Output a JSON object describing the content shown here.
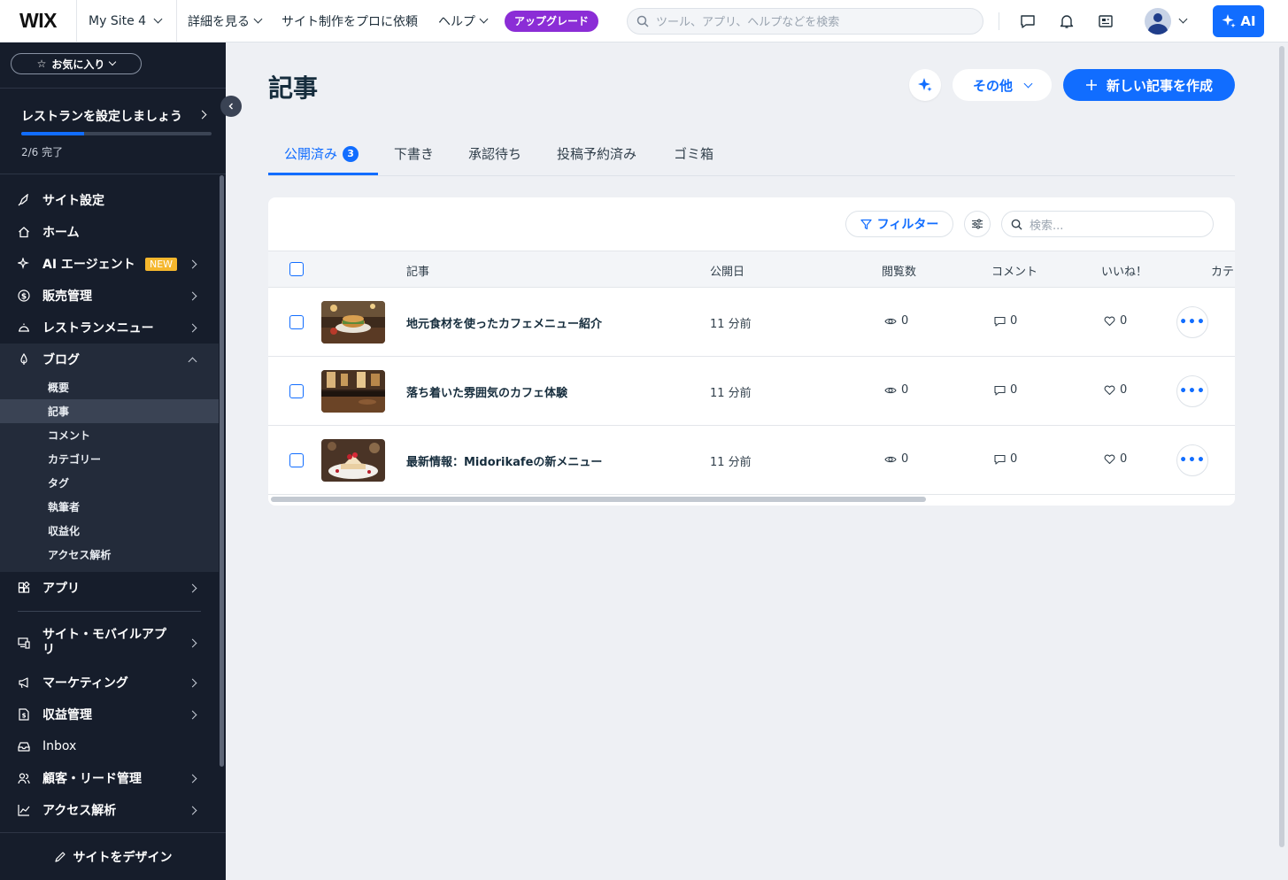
{
  "topbar": {
    "logo": "WIX",
    "site_name": "My Site 4",
    "nav": [
      "詳細を見る",
      "サイト制作をプロに依頼",
      "ヘルプ"
    ],
    "upgrade": "アップグレード",
    "search_placeholder": "ツール、アプリ、ヘルプなどを検索",
    "ai_label": "AI"
  },
  "sidebar": {
    "favorites": "お気に入り",
    "setup_title": "レストランを設定しましょう",
    "setup_progress": "2/6 完了",
    "setup_fraction": 0.33,
    "items": [
      {
        "label": "サイト設定"
      },
      {
        "label": "ホーム"
      },
      {
        "label": "AI エージェント",
        "badge": "NEW"
      },
      {
        "label": "販売管理"
      },
      {
        "label": "レストランメニュー"
      },
      {
        "label": "ブログ"
      },
      {
        "label": "アプリ"
      },
      {
        "label": "サイト・モバイルアプリ"
      },
      {
        "label": "マーケティング"
      },
      {
        "label": "収益管理"
      },
      {
        "label": "Inbox"
      },
      {
        "label": "顧客・リード管理"
      },
      {
        "label": "アクセス解析"
      }
    ],
    "blog_sub": [
      "概要",
      "記事",
      "コメント",
      "カテゴリー",
      "タグ",
      "執筆者",
      "収益化",
      "アクセス解析"
    ],
    "design_button": "サイトをデザイン"
  },
  "main": {
    "title": "記事",
    "more_button": "その他",
    "create_button": "新しい記事を作成",
    "tabs": [
      {
        "label": "公開済み",
        "count": "3"
      },
      {
        "label": "下書き"
      },
      {
        "label": "承認待ち"
      },
      {
        "label": "投稿予約済み"
      },
      {
        "label": "ゴミ箱"
      }
    ],
    "filter_button": "フィルター",
    "search_placeholder": "検索...",
    "columns": [
      "記事",
      "公開日",
      "閲覧数",
      "コメント",
      "いいね！",
      "カテ"
    ],
    "rows": [
      {
        "title": "地元食材を使ったカフェメニュー紹介",
        "date": "11 分前",
        "views": "0",
        "comments": "0",
        "likes": "0"
      },
      {
        "title": "落ち着いた雰囲気のカフェ体験",
        "date": "11 分前",
        "views": "0",
        "comments": "0",
        "likes": "0"
      },
      {
        "title": "最新情報：Midorikafeの新メニュー",
        "date": "11 分前",
        "views": "0",
        "comments": "0",
        "likes": "0"
      }
    ]
  },
  "colors": {
    "accent": "#116dff",
    "sidebar_bg": "#161d2b",
    "upgrade": "#8b2dd6",
    "badge": "#f5b72d"
  }
}
